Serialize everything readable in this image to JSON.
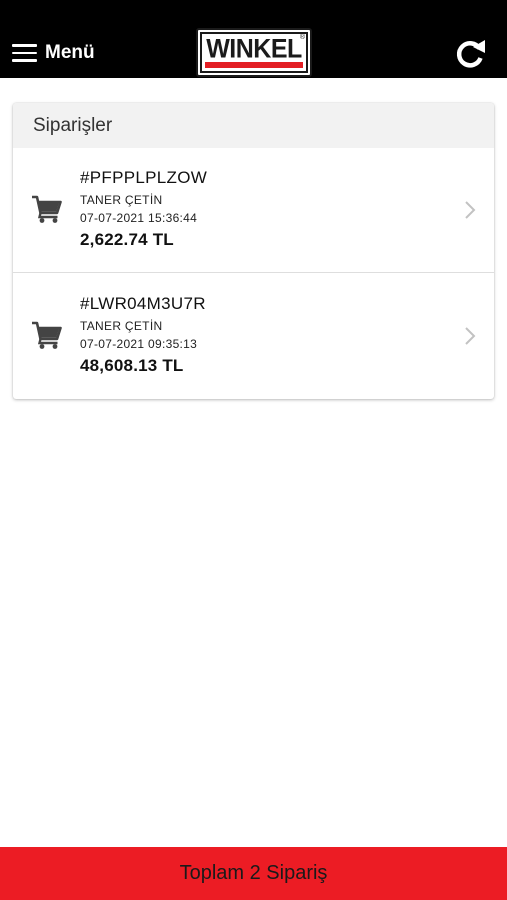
{
  "header": {
    "menu_label": "Menü",
    "logo_text": "WINKEL",
    "logo_reg_mark": "®"
  },
  "orders_panel": {
    "title": "Siparişler",
    "orders": [
      {
        "id": "#PFPPLPLZOW",
        "customer": "TANER ÇETİN",
        "datetime": "07-07-2021 15:36:44",
        "amount": "2,622.74 TL"
      },
      {
        "id": "#LWR04M3U7R",
        "customer": "TANER ÇETİN",
        "datetime": "07-07-2021 09:35:13",
        "amount": "48,608.13 TL"
      }
    ]
  },
  "footer": {
    "total_label": "Toplam 2 Sipariş"
  },
  "colors": {
    "header_bg": "#000000",
    "accent_red": "#ec1c24",
    "logo_red": "#e31e24",
    "card_header_bg": "#f2f2f2"
  },
  "icons": {
    "menu": "hamburger-menu-icon",
    "refresh": "refresh-icon",
    "order": "shopping-cart-icon",
    "row_action": "chevron-right-icon"
  }
}
